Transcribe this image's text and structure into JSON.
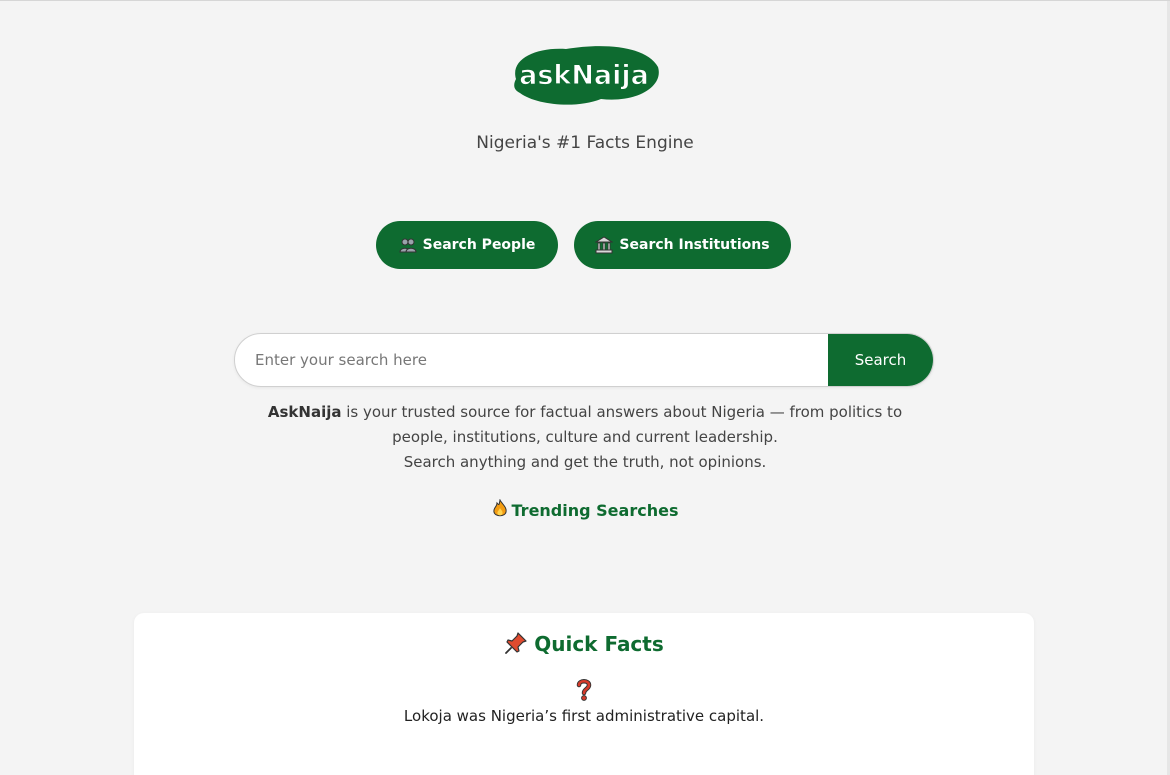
{
  "brand": {
    "logo_text": "askNaija",
    "tagline": "Nigeria's #1 Facts Engine",
    "color": "#0e6b30"
  },
  "actions": {
    "people_label": "Search People",
    "people_icon": "people-icon",
    "institutions_label": "Search Institutions",
    "institutions_icon": "bank-icon"
  },
  "search": {
    "placeholder": "Enter your search here",
    "value": "",
    "button_label": "Search"
  },
  "about": {
    "brand_name": "AskNaija",
    "line1_rest": " is your trusted source for factual answers about Nigeria — from politics to",
    "line2": "people, institutions, culture and current leadership.",
    "line3": "Search anything and get the truth, not opinions."
  },
  "trending": {
    "label": "Trending Searches",
    "icon": "fire-icon"
  },
  "quick_facts": {
    "title": "Quick Facts",
    "title_icon": "pushpin-icon",
    "fact_icon": "question-mark-icon",
    "fact": "Lokoja was Nigeria’s first administrative capital."
  }
}
